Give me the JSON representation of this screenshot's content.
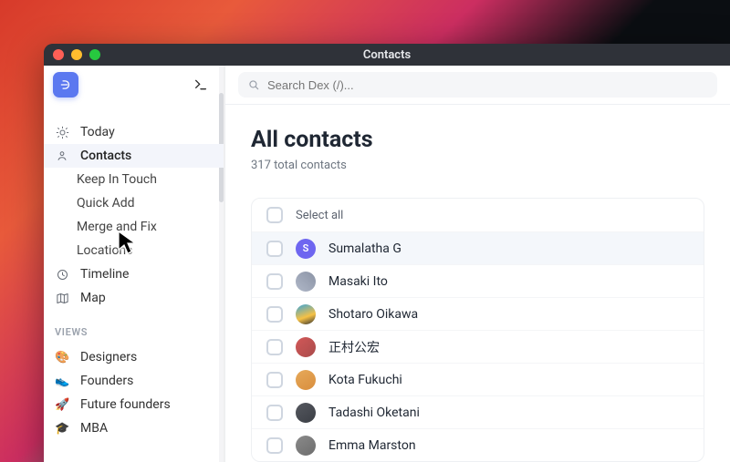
{
  "window": {
    "title": "Contacts"
  },
  "search": {
    "placeholder": "Search Dex (/)..."
  },
  "sidebar": {
    "nav": [
      {
        "icon": "sun",
        "label": "Today"
      },
      {
        "icon": "person",
        "label": "Contacts"
      },
      {
        "icon": "none",
        "label": "Keep In Touch"
      },
      {
        "icon": "none",
        "label": "Quick Add"
      },
      {
        "icon": "none",
        "label": "Merge and Fix"
      },
      {
        "icon": "none",
        "label": "Locations"
      },
      {
        "icon": "clock",
        "label": "Timeline"
      },
      {
        "icon": "map",
        "label": "Map"
      }
    ],
    "views_header": "VIEWS",
    "views": [
      {
        "emoji": "🎨",
        "label": "Designers"
      },
      {
        "emoji": "👟",
        "label": "Founders"
      },
      {
        "emoji": "🚀",
        "label": "Future founders"
      },
      {
        "emoji": "🎓",
        "label": "MBA"
      }
    ]
  },
  "main": {
    "title": "All contacts",
    "subtitle": "317 total contacts",
    "select_all": "Select all",
    "rows": [
      {
        "name": "Sumalatha G",
        "avatar_letter": "S"
      },
      {
        "name": "Masaki Ito"
      },
      {
        "name": "Shotaro Oikawa"
      },
      {
        "name": "正村公宏"
      },
      {
        "name": "Kota Fukuchi"
      },
      {
        "name": "Tadashi Oketani"
      },
      {
        "name": "Emma Marston"
      }
    ]
  }
}
